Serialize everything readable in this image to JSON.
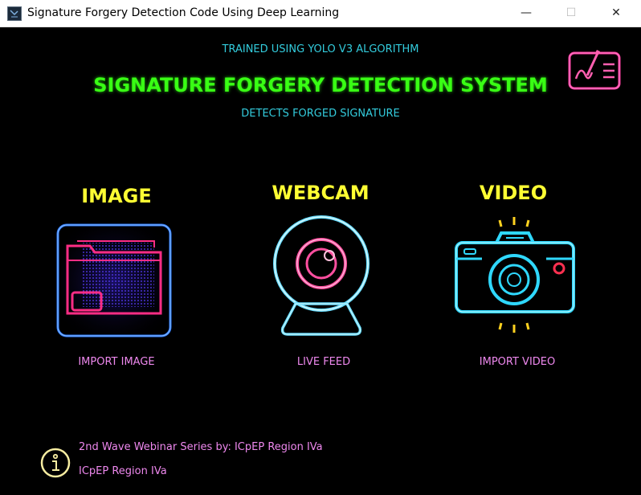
{
  "window": {
    "title": "Signature Forgery Detection Code Using Deep Learning",
    "minimize_glyph": "—",
    "maximize_glyph": "☐",
    "close_glyph": "✕"
  },
  "header": {
    "trained_text": "TRAINED USING YOLO V3 ALGORITHM",
    "title": "SIGNATURE FORGERY DETECTION SYSTEM",
    "subtitle": "DETECTS FORGED SIGNATURE"
  },
  "sections": {
    "image": {
      "title": "IMAGE",
      "action": "IMPORT IMAGE",
      "icon": "folder-icon"
    },
    "webcam": {
      "title": "WEBCAM",
      "action": "LIVE FEED",
      "icon": "webcam-icon"
    },
    "video": {
      "title": "VIDEO",
      "action": "IMPORT VIDEO",
      "icon": "camera-icon"
    }
  },
  "footer": {
    "line1": "2nd Wave Webinar Series by: ICpEP Region IVa",
    "line2": "ICpEP Region IVa"
  },
  "colors": {
    "title_green": "#39ff14",
    "cyan": "#33ccdd",
    "yellow": "#ffff33",
    "pink": "#ee88ee"
  }
}
